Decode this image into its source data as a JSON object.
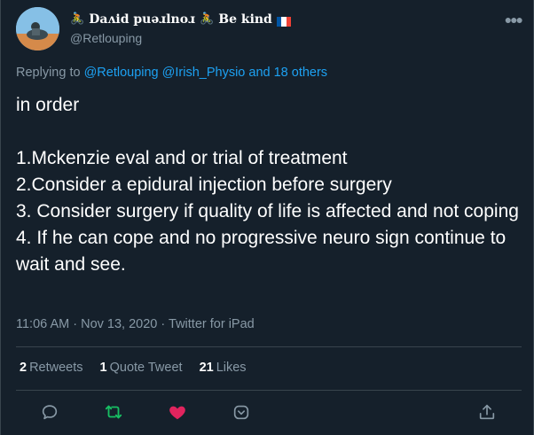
{
  "author": {
    "display_name": "Daʌid puǝɹlnoɹ",
    "display_name_suffix": "Be kind",
    "handle": "@Retlouping",
    "flag_colors": [
      "#0055a4",
      "#ffffff",
      "#ef4135"
    ]
  },
  "reply": {
    "prefix": "Replying to",
    "mentions": "@Retlouping @Irish_Physio and 18 others"
  },
  "tweet": {
    "lines": [
      "in order",
      "",
      "1.Mckenzie eval and or trial of treatment",
      "2.Consider a epidural injection before surgery",
      "3. Consider surgery if quality of life is affected and not coping",
      "4. If he can cope and no progressive neuro sign continue to wait and see."
    ]
  },
  "meta": {
    "time": "11:06 AM",
    "separator": "·",
    "date": "Nov 13, 2020",
    "source": "Twitter for iPad"
  },
  "stats": {
    "retweets_count": "2",
    "retweets_label": "Retweets",
    "quote_count": "1",
    "quote_label": "Quote Tweet",
    "likes_count": "21",
    "likes_label": "Likes"
  },
  "icons": {
    "reply": "reply-icon",
    "retweet": "retweet-icon",
    "like": "heart-icon",
    "bookmark": "bookmark-icon",
    "share": "share-icon",
    "more": "more-icon"
  },
  "colors": {
    "background": "#15202b",
    "text_secondary": "#8899a6",
    "link": "#1da1f2",
    "retweet_active": "#17bf63",
    "like_active": "#e0245e",
    "divider": "#38444d"
  }
}
